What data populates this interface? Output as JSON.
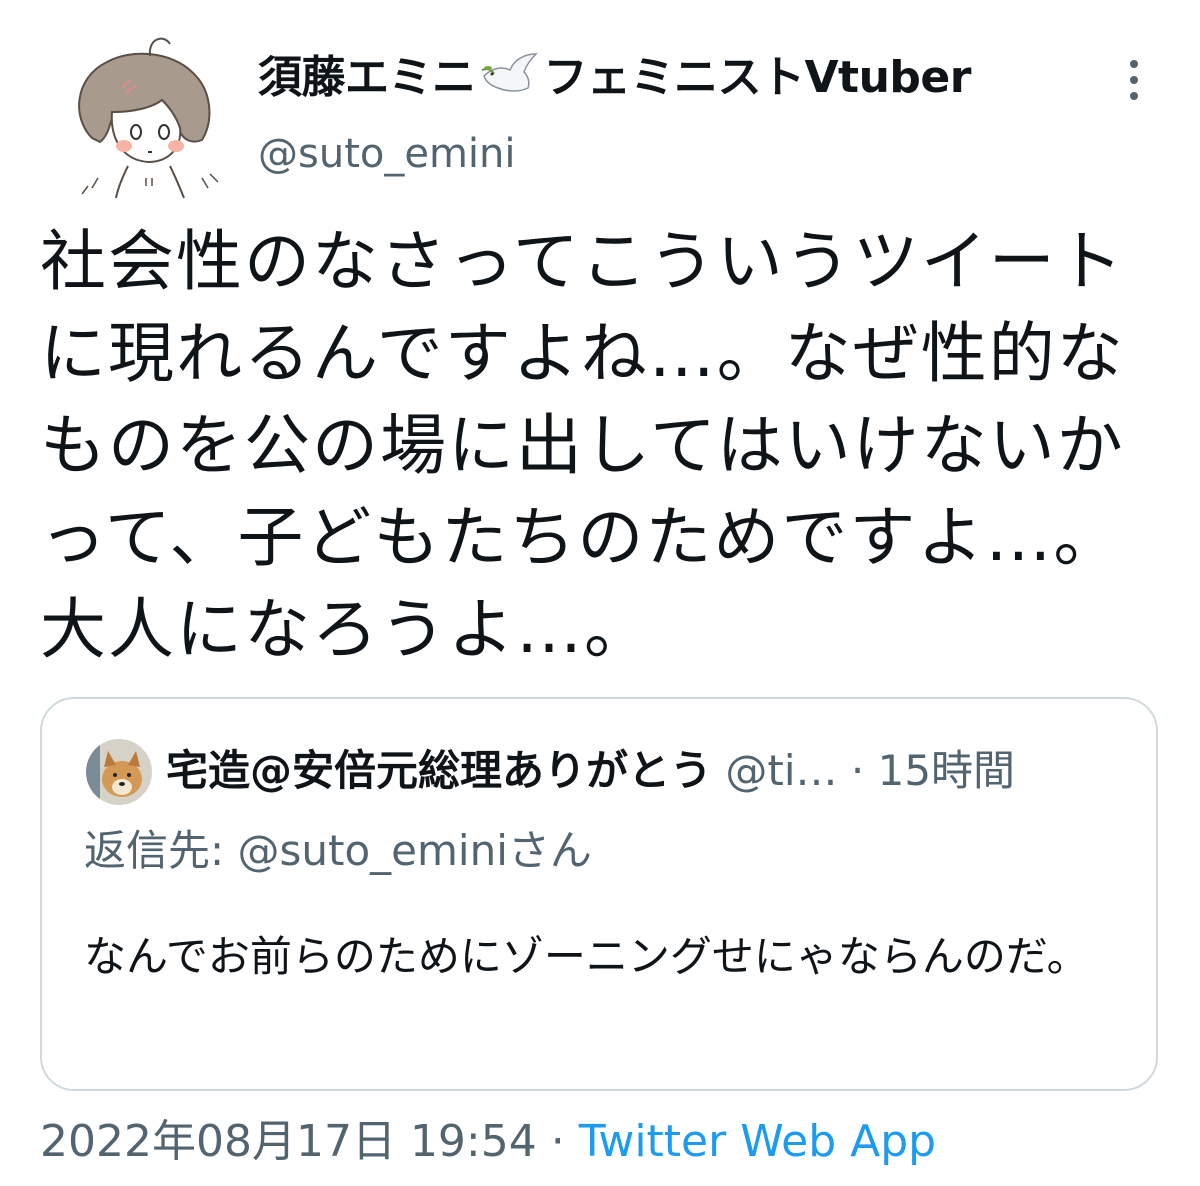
{
  "author": {
    "name_prefix": "須藤エミニ",
    "name_suffix": "フェミニストVtuber",
    "handle": "@suto_emini"
  },
  "tweet": {
    "text": "社会性のなさってこういうツイートに現れるんですよね…。なぜ性的なものを公の場に出してはいけないかって、子どもたちのためですよ…。大人になろうよ…。"
  },
  "quoted": {
    "name": "宅造@安倍元総理ありがとう",
    "handle": "@ti…",
    "separator": "·",
    "time": "15時間",
    "reply_prefix": "返信先:",
    "reply_mention": "@suto_eminiさん",
    "text": "なんでお前らのためにゾーニングせにゃならんのだ。"
  },
  "footer": {
    "timestamp": "2022年08月17日 19:54",
    "separator": "·",
    "source": "Twitter Web App"
  },
  "colors": {
    "text": "#0f1419",
    "secondary": "#536471",
    "link": "#1d9bf0",
    "border": "#cfd9de"
  },
  "icons": {
    "avatar": "drawn-girl-avatar",
    "name_emoji": "dove-icon",
    "more": "more-dots-icon",
    "quoted_avatar": "dog-avatar"
  }
}
